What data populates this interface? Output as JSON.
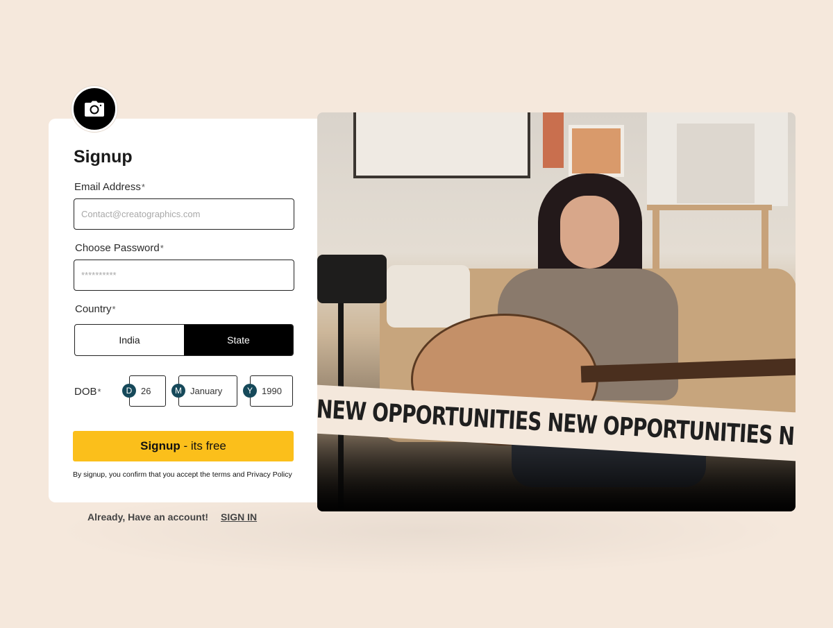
{
  "form": {
    "title": "Signup",
    "email": {
      "label": "Email Address",
      "required": "*",
      "placeholder": "Contact@creatographics.com"
    },
    "password": {
      "label": "Choose Password",
      "required": "*",
      "placeholder": "**********"
    },
    "country": {
      "label": "Country",
      "required": "*",
      "options": [
        "India",
        "State"
      ],
      "selected": "State"
    },
    "dob": {
      "label": "DOB",
      "required": "*",
      "day": {
        "badge": "D",
        "value": "26"
      },
      "month": {
        "badge": "M",
        "value": "January"
      },
      "year": {
        "badge": "Y",
        "value": "1990"
      }
    },
    "submit": {
      "bold": "Signup",
      "rest": " - its free"
    },
    "terms": "By signup, you confirm that you accept the terms and Privacy Policy"
  },
  "footer": {
    "prompt": "Already, Have an account!",
    "link": "SIGN IN"
  },
  "hero": {
    "banner_text": "NEW OPPORTUNITIES NEW OPPORTUNITIES NEW OPP"
  },
  "icons": {
    "avatar": "camera-icon"
  },
  "colors": {
    "accent": "#fbbf1b",
    "background": "#f5e8dc",
    "badge": "#16495a",
    "selected_segment": "#000000"
  }
}
